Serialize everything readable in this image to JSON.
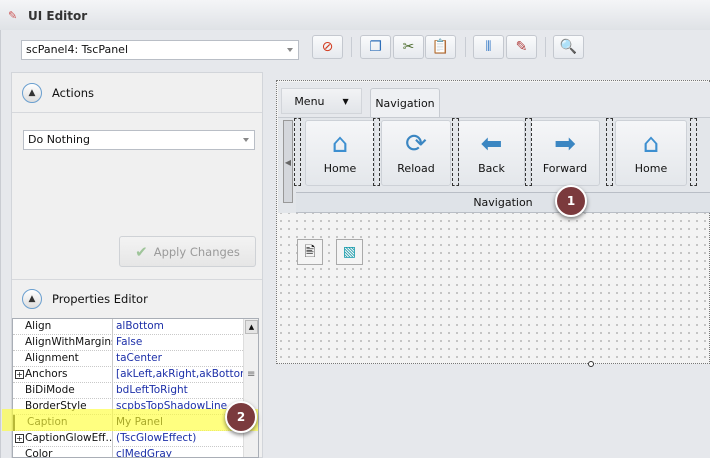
{
  "window": {
    "title": "UI Editor"
  },
  "toolbar": {
    "component_select": "scPanel4: TscPanel",
    "buttons": [
      "stop-icon",
      "copy-icon",
      "cut-icon",
      "paste-icon",
      "align-icon",
      "edit-icon",
      "search-icon"
    ]
  },
  "actions": {
    "header": "Actions",
    "action_select": "Do Nothing",
    "apply_label": "Apply Changes"
  },
  "properties": {
    "header": "Properties Editor",
    "rows": [
      {
        "name": "Align",
        "value": "alBottom",
        "expandable": false
      },
      {
        "name": "AlignWithMargins",
        "value": "False",
        "expandable": false
      },
      {
        "name": "Alignment",
        "value": "taCenter",
        "expandable": false
      },
      {
        "name": "Anchors",
        "value": "[akLeft,akRight,akBottom]",
        "expandable": true
      },
      {
        "name": "BiDiMode",
        "value": "bdLeftToRight",
        "expandable": false
      },
      {
        "name": "BorderStyle",
        "value": "scpbsTopShadowLine",
        "expandable": false
      },
      {
        "name": "Caption",
        "value": "My Panel",
        "expandable": false
      },
      {
        "name": "CaptionGlowEff...",
        "value": "(TscGlowEffect)",
        "expandable": true
      },
      {
        "name": "Color",
        "value": "clMedGray",
        "expandable": false
      }
    ]
  },
  "designer": {
    "menu_tab": "Menu",
    "nav_tab": "Navigation",
    "buttons": [
      "Home",
      "Reload",
      "Back",
      "Forward",
      "Home"
    ],
    "group_caption": "Navigation"
  },
  "callouts": [
    "1",
    "2"
  ],
  "colors": {
    "callout": "#7b3a3d",
    "highlight": "#ffff3c"
  }
}
